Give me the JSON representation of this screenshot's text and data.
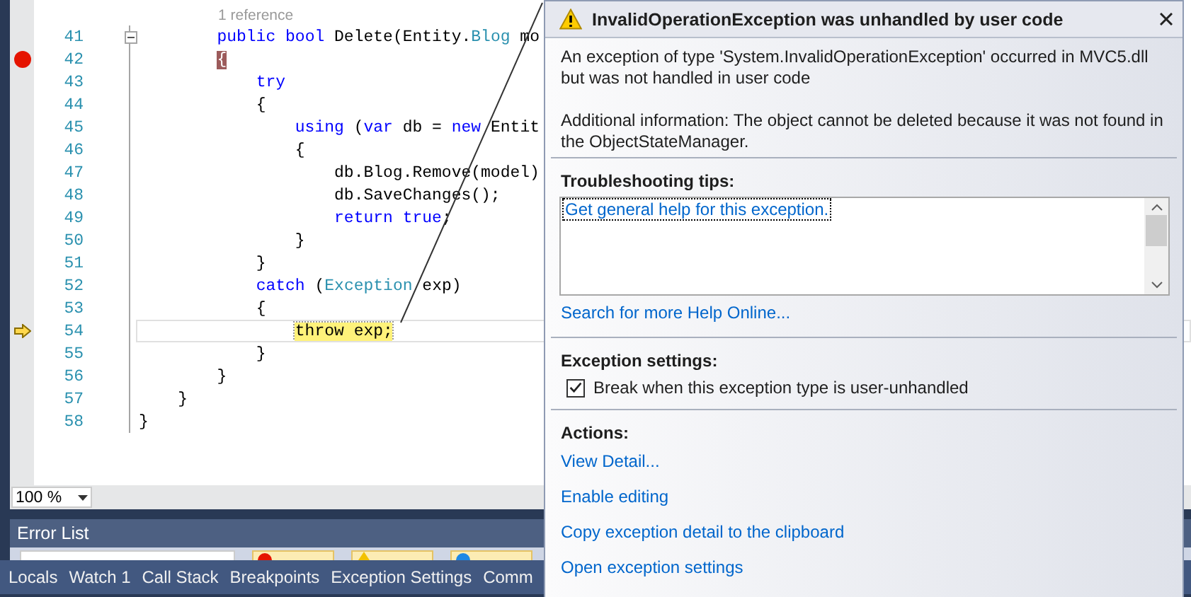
{
  "editor": {
    "reference_hint": "1 reference",
    "lines": [
      {
        "number": "41",
        "breakpoint": false,
        "current": false,
        "collapsible": true,
        "tokens": [
          {
            "kind": "keyword",
            "text": "        public bool "
          },
          {
            "kind": "plain",
            "text": "Delete(Entity."
          },
          {
            "kind": "type",
            "text": "Blog"
          },
          {
            "kind": "plain",
            "text": " mo"
          }
        ]
      },
      {
        "number": "42",
        "breakpoint": true,
        "current": false,
        "collapsible": false,
        "tokens": [
          {
            "kind": "breakpoint",
            "text": "        {"
          }
        ]
      },
      {
        "number": "43",
        "breakpoint": false,
        "current": false,
        "collapsible": false,
        "tokens": [
          {
            "kind": "keyword",
            "text": "            try"
          }
        ]
      },
      {
        "number": "44",
        "breakpoint": false,
        "current": false,
        "collapsible": false,
        "tokens": [
          {
            "kind": "plain",
            "text": "            {"
          }
        ]
      },
      {
        "number": "45",
        "breakpoint": false,
        "current": false,
        "collapsible": false,
        "tokens": [
          {
            "kind": "keyword",
            "text": "                using"
          },
          {
            "kind": "plain",
            "text": " ("
          },
          {
            "kind": "keyword",
            "text": "var"
          },
          {
            "kind": "plain",
            "text": " db = "
          },
          {
            "kind": "keyword",
            "text": "new"
          },
          {
            "kind": "plain",
            "text": " Entit"
          }
        ]
      },
      {
        "number": "46",
        "breakpoint": false,
        "current": false,
        "collapsible": false,
        "tokens": [
          {
            "kind": "plain",
            "text": "                {"
          }
        ]
      },
      {
        "number": "47",
        "breakpoint": false,
        "current": false,
        "collapsible": false,
        "tokens": [
          {
            "kind": "plain",
            "text": "                    db.Blog.Remove(model)"
          }
        ]
      },
      {
        "number": "48",
        "breakpoint": false,
        "current": false,
        "collapsible": false,
        "tokens": [
          {
            "kind": "plain",
            "text": "                    db.SaveChanges();"
          }
        ]
      },
      {
        "number": "49",
        "breakpoint": false,
        "current": false,
        "collapsible": false,
        "tokens": [
          {
            "kind": "keyword",
            "text": "                    return true"
          },
          {
            "kind": "plain",
            "text": ";"
          }
        ]
      },
      {
        "number": "50",
        "breakpoint": false,
        "current": false,
        "collapsible": false,
        "tokens": [
          {
            "kind": "plain",
            "text": "                }"
          }
        ]
      },
      {
        "number": "51",
        "breakpoint": false,
        "current": false,
        "collapsible": false,
        "tokens": [
          {
            "kind": "plain",
            "text": "            }"
          }
        ]
      },
      {
        "number": "52",
        "breakpoint": false,
        "current": false,
        "collapsible": false,
        "tokens": [
          {
            "kind": "keyword",
            "text": "            catch"
          },
          {
            "kind": "plain",
            "text": " ("
          },
          {
            "kind": "type",
            "text": "Exception"
          },
          {
            "kind": "plain",
            "text": " exp)"
          }
        ]
      },
      {
        "number": "53",
        "breakpoint": false,
        "current": false,
        "collapsible": false,
        "tokens": [
          {
            "kind": "plain",
            "text": "            {"
          }
        ]
      },
      {
        "number": "54",
        "breakpoint": false,
        "current": true,
        "collapsible": false,
        "tokens": [
          {
            "kind": "current",
            "text": "                throw exp;"
          }
        ]
      },
      {
        "number": "55",
        "breakpoint": false,
        "current": false,
        "collapsible": false,
        "tokens": [
          {
            "kind": "plain",
            "text": "            }"
          }
        ]
      },
      {
        "number": "56",
        "breakpoint": false,
        "current": false,
        "collapsible": false,
        "tokens": [
          {
            "kind": "plain",
            "text": "        }"
          }
        ]
      },
      {
        "number": "57",
        "breakpoint": false,
        "current": false,
        "collapsible": false,
        "tokens": [
          {
            "kind": "plain",
            "text": "    }"
          }
        ]
      },
      {
        "number": "58",
        "breakpoint": false,
        "current": false,
        "collapsible": false,
        "tokens": [
          {
            "kind": "plain",
            "text": "}"
          }
        ]
      }
    ],
    "zoom": "100 %"
  },
  "error_list": {
    "title": "Error List"
  },
  "tool_tabs": [
    "Locals",
    "Watch 1",
    "Call Stack",
    "Breakpoints",
    "Exception Settings",
    "Comm"
  ],
  "dialog": {
    "title": "InvalidOperationException was unhandled by user code",
    "message": "An exception of type 'System.InvalidOperationException' occurred in MVC5.dll but was not handled in user code",
    "additional_info": "Additional information: The object cannot be deleted because it was not found in the ObjectStateManager.",
    "troubleshooting": {
      "heading": "Troubleshooting tips:",
      "tips": [
        {
          "text": "Get general help for this exception.",
          "focused": true
        }
      ]
    },
    "search_link": "Search for more Help Online...",
    "settings": {
      "heading": "Exception settings:",
      "option": {
        "label": "Break when this exception type is user-unhandled",
        "checked": true
      }
    },
    "actions": {
      "heading": "Actions:",
      "links": [
        "View Detail...",
        "Enable editing",
        "Copy exception detail to the clipboard",
        "Open exception settings"
      ]
    }
  }
}
